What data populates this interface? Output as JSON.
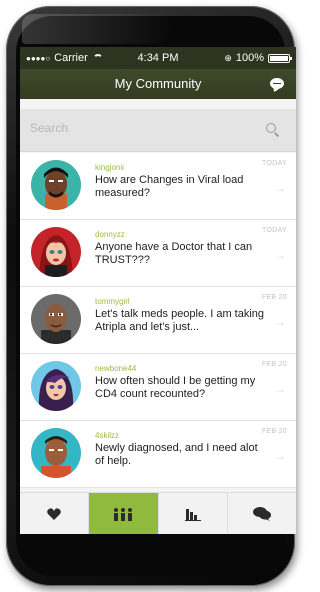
{
  "status": {
    "carrier": "Carrier",
    "time": "4:34 PM",
    "battery": "100%"
  },
  "nav": {
    "title": "My Community"
  },
  "search": {
    "placeholder": "Search"
  },
  "threads": [
    {
      "user": "kingjonii",
      "date": "TODAY",
      "message": "How are Changes in Viral load measured?"
    },
    {
      "user": "donnyzz",
      "date": "TODAY",
      "message": "Anyone have a Doctor that I can TRUST???"
    },
    {
      "user": "tommygirl",
      "date": "FEB 20",
      "message": "Let's talk meds people. I am taking Atripla  and let's just..."
    },
    {
      "user": "newbone44",
      "date": "FEB 20",
      "message": "How often should I be getting my CD4 count recounted?"
    },
    {
      "user": "4skilzz",
      "date": "FEB 20",
      "message": "Newly diagnosed, and I need alot of help."
    }
  ],
  "tabs": [
    {
      "icon": "heart-icon"
    },
    {
      "icon": "community-icon",
      "active": true
    },
    {
      "icon": "bar-chart-icon"
    },
    {
      "icon": "chat-bubbles-icon"
    }
  ],
  "colors": {
    "accent": "#8fba3e",
    "navbar": "#3a4226",
    "username": "#9bbc44"
  }
}
